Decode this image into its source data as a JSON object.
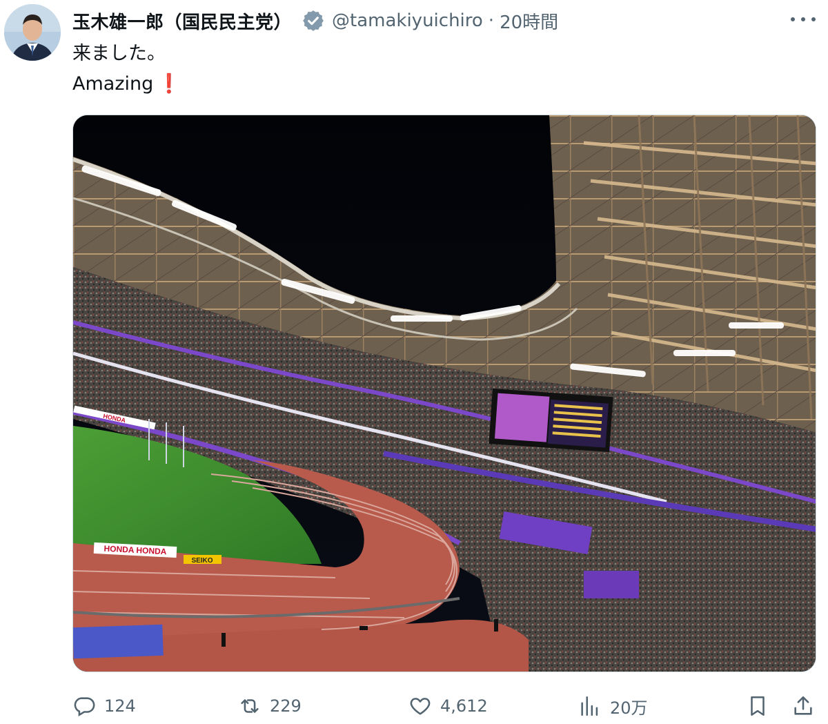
{
  "tweet": {
    "author_name": "玉木雄一郎（国民民主党）",
    "handle": "@tamakiyuichiro",
    "separator": "·",
    "timestamp": "20時間",
    "text_lines": [
      "来ました。",
      "Amazing"
    ],
    "text_emoji": "❗",
    "media_alt": "stadium-photo"
  },
  "actions": {
    "replies": "124",
    "reposts": "229",
    "likes": "4,612",
    "views": "20万"
  },
  "colors": {
    "verified": "#829aab",
    "muted": "#536471",
    "text": "#0f1419",
    "exclaim": "#dd2e44",
    "track": "#b85a4c",
    "grass": "#3a8a2e",
    "night_sky": "#05070d",
    "purple_signage": "#7a48c8"
  },
  "stadium_signage": {
    "ad_1": "HONDA",
    "ad_2": "SEIKO",
    "ad_3": "HONDA HONDA"
  }
}
